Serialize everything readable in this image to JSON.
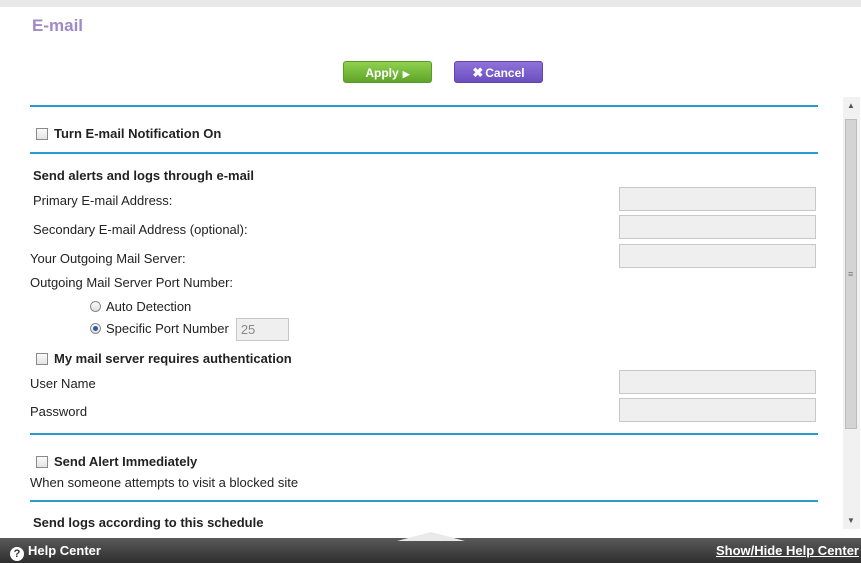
{
  "page": {
    "title": "E-mail"
  },
  "toolbar": {
    "apply_label": "Apply",
    "cancel_label": "Cancel"
  },
  "notification": {
    "label": "Turn E-mail Notification On",
    "checked": false
  },
  "send_section": {
    "heading": "Send alerts and logs through e-mail",
    "primary_email_label": "Primary E-mail Address:",
    "primary_email_value": "",
    "secondary_email_label": "Secondary E-mail Address (optional):",
    "secondary_email_value": "",
    "outgoing_server_label": "Your Outgoing Mail Server:",
    "outgoing_server_value": "",
    "port_label": "Outgoing Mail Server Port Number:",
    "auto_detection_label": "Auto Detection",
    "specific_port_label": "Specific Port Number",
    "port_value": "25",
    "selected_port_option": "Specific Port Number"
  },
  "auth": {
    "label": "My mail server requires authentication",
    "checked": false,
    "username_label": "User Name",
    "username_value": "",
    "password_label": "Password",
    "password_value": ""
  },
  "alert": {
    "label": "Send Alert Immediately",
    "checked": false,
    "description": "When someone attempts to visit a blocked site"
  },
  "schedule": {
    "heading": "Send logs according to this schedule"
  },
  "footer": {
    "help_center_label": "Help Center",
    "show_hide_label": "Show/Hide Help Center"
  },
  "colors": {
    "accent_line": "#2a9bd0",
    "title": "#9e8ac7",
    "apply": "#6db33f",
    "cancel": "#7b5fcf"
  }
}
